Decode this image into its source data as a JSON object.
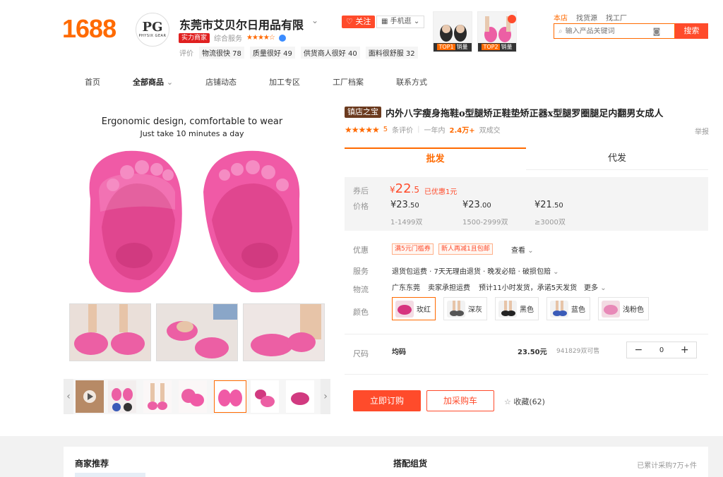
{
  "header": {
    "logo": "1688",
    "shop_avatar_text": "PG",
    "shop_avatar_sub": "PHYSIX GEAR",
    "shop_name": "东莞市艾贝尔日用品有限",
    "follow_label": "关注",
    "mobile_label": "手机逛",
    "strength_badge": "实力商家",
    "service_label": "综合服务",
    "stars": "★★★★☆",
    "review_label": "评价",
    "review_tags": [
      "物流很快 78",
      "质量很好 49",
      "供货商人很好 40",
      "面料很舒服 32"
    ],
    "top_products": [
      {
        "rank": "TOP1",
        "label": "销量"
      },
      {
        "rank": "TOP2",
        "label": "销量"
      }
    ],
    "search_tabs": [
      "本店",
      "找货源",
      "找工厂"
    ],
    "search_placeholder": "输入产品关键词",
    "search_button": "搜索"
  },
  "nav": {
    "items": [
      "首页",
      "全部商品",
      "店铺动态",
      "加工专区",
      "工厂档案",
      "联系方式"
    ]
  },
  "gallery": {
    "hero_line1": "Ergonomic design, comfortable to wear",
    "hero_line2": "Just take 10 minutes a day"
  },
  "product": {
    "store_badge": "镇店之宝",
    "title": "内外八字瘦身拖鞋o型腿矫正鞋垫矫正器x型腿罗圈腿足内翻男女成人",
    "stars": "★★★★★",
    "review_count": "5",
    "review_suffix": "条评价",
    "period": "一年内",
    "sold": "2.4万+",
    "sold_suffix": "双成交",
    "report": "举报"
  },
  "tabs": {
    "wholesale": "批发",
    "dropship": "代发"
  },
  "price": {
    "coupon_label": "券后",
    "coupon_symbol": "¥",
    "coupon_int": "22",
    "coupon_dec": ".5",
    "coupon_note": "已优惠1元",
    "price_label": "价格",
    "tiers": [
      {
        "int": "¥23",
        "dec": ".50",
        "qty": "1-1499双"
      },
      {
        "int": "¥23",
        "dec": ".00",
        "qty": "1500-2999双"
      },
      {
        "int": "¥21",
        "dec": ".50",
        "qty": "≥3000双"
      }
    ]
  },
  "details": {
    "promo_label": "优惠",
    "promo_tags": [
      "满5元门槛券",
      "新人再减1且包邮"
    ],
    "promo_more": "查看",
    "service_label": "服务",
    "service_text": "退货包运费 · 7天无理由退货 · 晚发必赔 · 破损包赔",
    "logistics_label": "物流",
    "origin": "广东东莞",
    "freight": "卖家承担运费",
    "shipping": "预计11小时发货，承诺5天发货",
    "more": "更多",
    "color_label": "颜色",
    "colors": [
      "玫红",
      "深灰",
      "黑色",
      "蓝色",
      "浅粉色"
    ],
    "size_label": "尺码",
    "size_value": "均码",
    "size_price": "23.50元",
    "stock": "941829双可售",
    "quantity": "0"
  },
  "actions": {
    "buy": "立即订购",
    "cart": "加采购车",
    "favorite": "收藏(62)"
  },
  "bottom": {
    "recommend_title": "商家推荐",
    "bundle_title": "搭配组货",
    "bundle_note": "已累计采购7万+件"
  }
}
